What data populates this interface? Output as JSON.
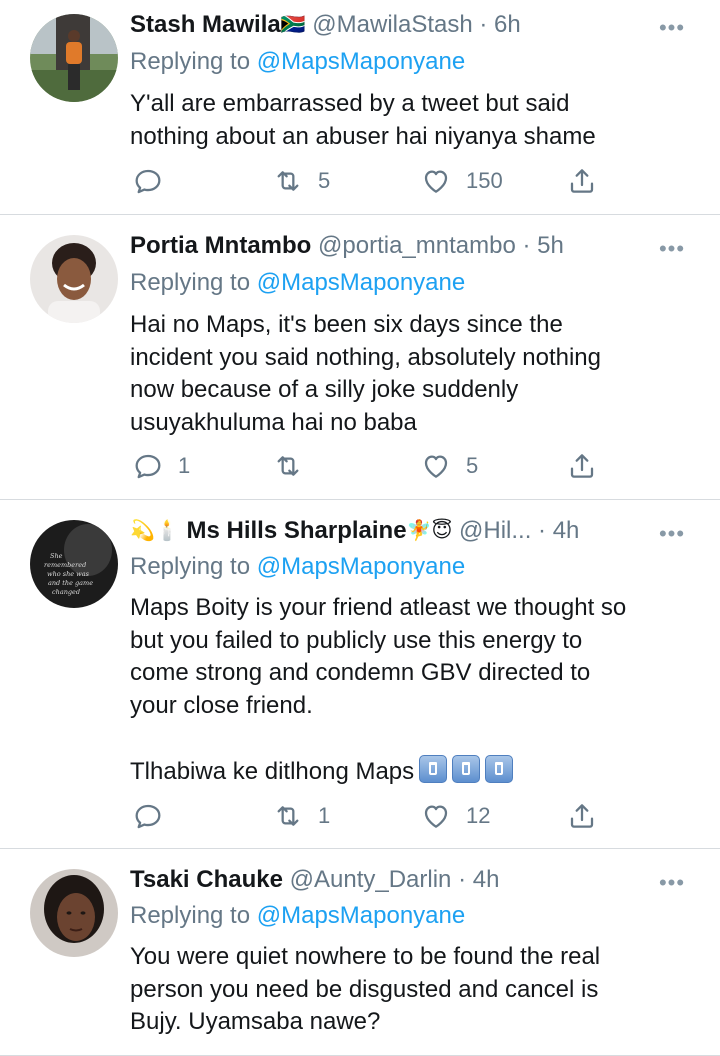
{
  "tweets": [
    {
      "name": "Stash Mawila",
      "flag": "🇿🇦",
      "handle": "@MawilaStash",
      "time": "· 6h",
      "replying_prefix": "Replying to",
      "replying_to": "@MapsMaponyane",
      "text": "Y'all are embarrassed by a tweet but said\nnothing about an abuser hai niyanya shame",
      "reply_count": "",
      "retweet_count": "5",
      "like_count": "150",
      "avatar": "man-standing-photo"
    },
    {
      "name": "Portia Mntambo",
      "handle": "@portia_mntambo",
      "time": "· 5h",
      "replying_prefix": "Replying to",
      "replying_to": "@MapsMaponyane",
      "text": "Hai no Maps, it's been six days since the\nincident you said nothing, absolutely nothing\nnow because of a silly joke suddenly\nusuyakhuluma hai no baba",
      "reply_count": "1",
      "retweet_count": "",
      "like_count": "5",
      "avatar": "woman-portrait-photo"
    },
    {
      "name": "Ms Hills Sharplaine",
      "name_prefix_emojis": "💫🕯️",
      "name_suffix_emojis": "🧚😇",
      "handle": "@Hil...",
      "time": "· 4h",
      "replying_prefix": "Replying to",
      "replying_to": "@MapsMaponyane",
      "text": "Maps Boity is your friend atleast we thought so\nbut you failed to publicly use this energy to\ncome strong and condemn GBV directed to\nyour close friend.\n\nTlhabiwa ke ditlhong Maps",
      "text_trailing_emojis": [
        "trash-can",
        "trash-can",
        "trash-can"
      ],
      "reply_count": "",
      "retweet_count": "1",
      "like_count": "12",
      "avatar": "dark-text-art",
      "avatar_text": [
        "She",
        "remembered",
        "who she was",
        "and the game",
        "changed"
      ]
    },
    {
      "name": "Tsaki Chauke",
      "handle": "@Aunty_Darlin",
      "time": "· 4h",
      "replying_prefix": "Replying to",
      "replying_to": "@MapsMaponyane",
      "text": "You were quiet nowhere to be found the real\nperson you need be disgusted and cancel is\nBujy. Uyamsaba nawe?",
      "avatar": "woman-face-photo"
    }
  ],
  "more_label": "•••",
  "colors": {
    "text": "#14171a",
    "muted": "#657786",
    "link": "#1da1f2",
    "divider": "#d7dbdf"
  }
}
